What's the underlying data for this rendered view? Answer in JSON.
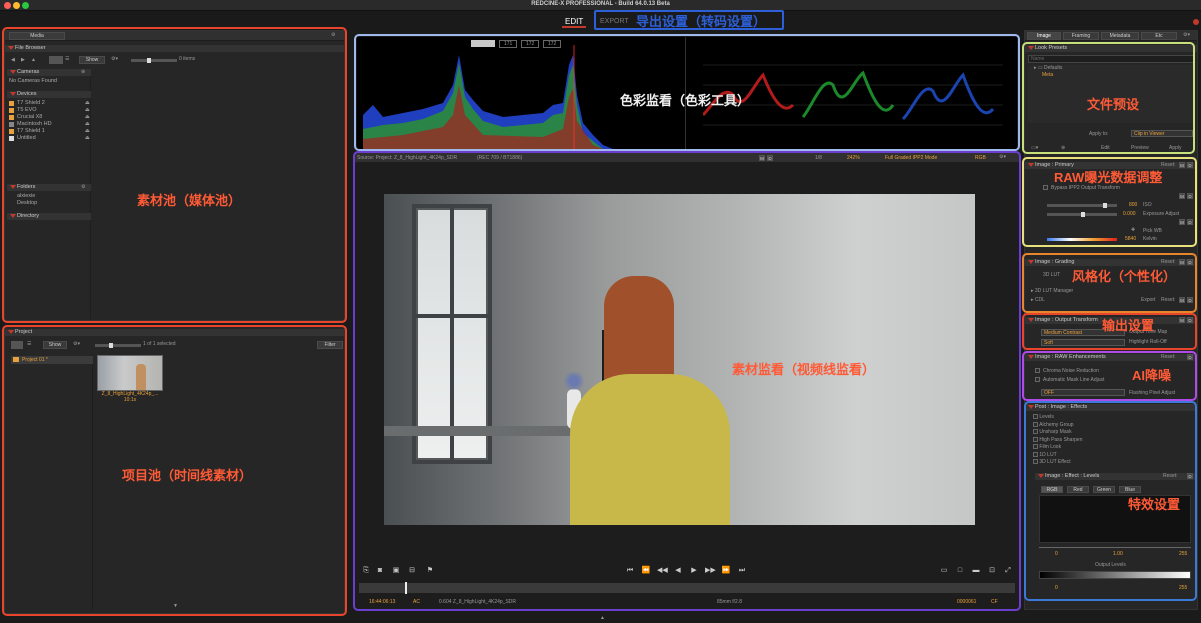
{
  "app": {
    "title": "REDCINE-X PROFESSIONAL - Build 64.0.13 Beta",
    "mode_edit": "EDIT",
    "mode_export": "EXPORT"
  },
  "media": {
    "tab": "Media",
    "file_browser": "File Browser",
    "show": "Show",
    "items": "0 items",
    "cameras": "Cameras",
    "no_cameras": "No Cameras Found",
    "devices": "Devices",
    "device_list": [
      "T7 Shield 2",
      "T5 EVO",
      "Crucial X8",
      "Macintosh HD",
      "T7 Shield 1",
      "Untitled"
    ],
    "folders": "Folders",
    "folder_list": [
      "alxiexie",
      "Desktop"
    ],
    "directory": "Directory"
  },
  "project": {
    "title": "Project",
    "show": "Show",
    "selected": "1 of 1 selected",
    "filter": "Filter",
    "tree_item": "Project 01 *",
    "clip_name": "Z_8_HighLight_4K24p_...",
    "clip_duration": "10:1s"
  },
  "scopes": {
    "tabs": [
      "171",
      "172",
      "172"
    ]
  },
  "viewer": {
    "source": "Source: Project: Z_8_HighLight_4K24p_SDR",
    "colorspace": "(REC 709 / BT1886)",
    "ratio": "1/8",
    "zoom": "242%",
    "mode": "Full Graded IPP2 Mode",
    "channel": "RGB",
    "timecode": "16:44:06:13",
    "ac": "AC",
    "clip_info": "0.604 Z_8_HighLight_4K24p_SDR",
    "lens": "85mm  f/2.8",
    "frame": "0000061",
    "cf": "CF",
    "playhead": 0.07
  },
  "right": {
    "tabs": [
      "Image",
      "Framing",
      "Metadata",
      "Etc"
    ],
    "look_presets": "Look Presets",
    "name_placeholder": "Name",
    "defaults": "Defaults",
    "meta": "Meta",
    "apply_to": "Apply to:",
    "apply_target": "Clip in Viewer",
    "edit": "Edit",
    "preview": "Preview",
    "apply": "Apply",
    "primary": "Image : Primary",
    "reset": "Reset:",
    "bypass": "Bypass IPP2 Output Transform",
    "iso_val": "800",
    "iso": "ISO",
    "exposure_val": "0.000",
    "exposure": "Exposure Adjust",
    "pick_wb": "Pick WB",
    "kelvin_val": "5840",
    "kelvin": "Kelvin",
    "grading": "Image : Grading",
    "lut3d": "3D LUT",
    "lut_manager": "3D LUT Manager",
    "cdl": "CDL",
    "export": "Export",
    "output": "Image : Output Transform",
    "contrast": "Medium Contrast",
    "tone_map": "Output Tone Map",
    "rolloff": "Soft",
    "highlight": "Highlight Roll-Off",
    "raw": "Image : RAW Enhancements",
    "chroma": "Chroma Noise Reduction",
    "mask": "Automatic Mask Line Adjust",
    "off": "OFF",
    "flashing": "Flashing Pixel Adjust",
    "effects": "Post : Image : Effects",
    "effect_list": [
      "Levels",
      "Alchemy Group",
      "Unsharp Mask",
      "High Pass Sharpen",
      "Film Look",
      "1D LUT",
      "3D LUT Effect"
    ],
    "levels": "Image : Effect : Levels",
    "level_tabs": [
      "RGB",
      "Red",
      "Green",
      "Blue"
    ],
    "in_min": "0",
    "in_mid": "1.00",
    "in_max": "255",
    "output_levels": "Output Levels",
    "out_min": "0",
    "out_max": "255"
  },
  "annotations": {
    "media_pool": "素材池（媒体池）",
    "project_pool": "项目池（时间线素材）",
    "color_monitor": "色彩监看（色彩工具）",
    "export": "导出设置（转码设置）",
    "viewer": "素材监看（视频线监看）",
    "presets": "文件预设",
    "raw": "RAW曝光数据调整",
    "style": "风格化（个性化）",
    "output": "输出设置",
    "ai": "AI降噪",
    "effects": "特效设置"
  },
  "colors": {
    "orange_frame": "#e8452c",
    "blue_frame": "#3b6fd8",
    "lightblue_frame": "#8fb0e8",
    "purple_frame": "#6a3fd0",
    "green_frame": "#c8e07a",
    "yellow_frame": "#e8d86a",
    "darkorange_frame": "#e87a2c",
    "violet_frame": "#a24bd8",
    "accent_orange": "#e9a23b"
  }
}
